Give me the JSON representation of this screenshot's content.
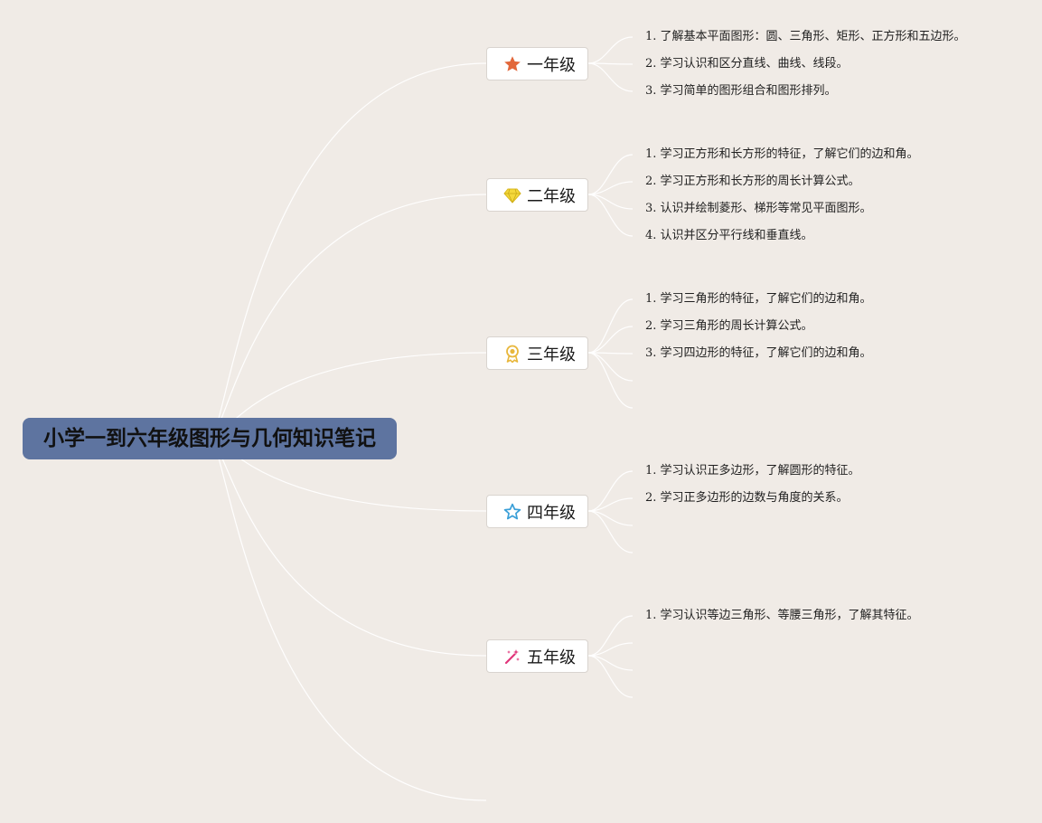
{
  "root": {
    "title": "小学一到六年级图形与几何知识笔记"
  },
  "colors": {
    "background": "#f0ebe6",
    "root_fill": "#5e74a0",
    "connector": "#ffffff",
    "icon_star": "#e2673a",
    "icon_diamond": "#f4d83a",
    "icon_medal": "#e8b73c",
    "icon_star_outline": "#3a9fd8",
    "icon_wand": "#e0357a"
  },
  "grades": [
    {
      "label": "一年级",
      "icon": "star-icon",
      "items": [
        "1. 了解基本平面图形：圆、三角形、矩形、正方形和五边形。",
        "2. 学习认识和区分直线、曲线、线段。",
        "3. 学习简单的图形组合和图形排列。"
      ]
    },
    {
      "label": "二年级",
      "icon": "diamond-icon",
      "items": [
        "1. 学习正方形和长方形的特征，了解它们的边和角。",
        "2. 学习正方形和长方形的周长计算公式。",
        "3. 认识并绘制菱形、梯形等常见平面图形。",
        "4. 认识并区分平行线和垂直线。"
      ]
    },
    {
      "label": "三年级",
      "icon": "medal-icon",
      "items": [
        "1. 学习三角形的特征，了解它们的边和角。",
        "2. 学习三角形的周长计算公式。",
        "3. 学习四边形的特征，了解它们的边和角。"
      ]
    },
    {
      "label": "四年级",
      "icon": "star-outline-icon",
      "items": [
        "1. 学习认识正多边形，了解圆形的特征。",
        "2. 学习正多边形的边数与角度的关系。"
      ]
    },
    {
      "label": "五年级",
      "icon": "magic-wand-icon",
      "items": [
        "1. 学习认识等边三角形、等腰三角形，了解其特征。"
      ]
    }
  ]
}
